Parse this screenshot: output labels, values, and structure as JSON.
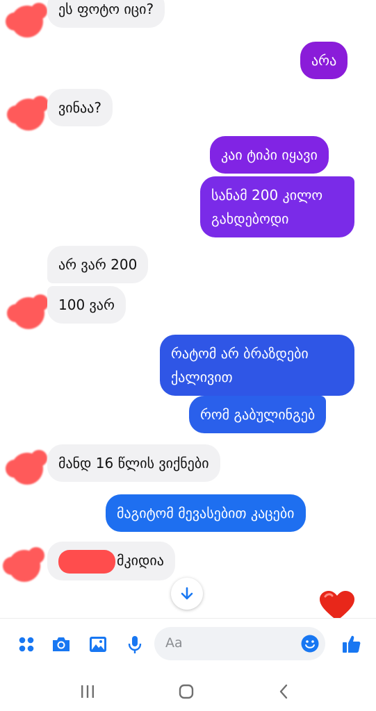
{
  "chat": {
    "messages": [
      {
        "side": "in",
        "text": "ეს ფოტო იცი?"
      },
      {
        "side": "out",
        "text": "არა"
      },
      {
        "side": "in",
        "text": "ვინაა?"
      },
      {
        "side": "out",
        "text": "კაი ტიპი იყავი"
      },
      {
        "side": "out",
        "text": "სანამ 200 კილო გახდებოდი"
      },
      {
        "side": "in",
        "text": "არ ვარ 200"
      },
      {
        "side": "in",
        "text": "100 ვარ"
      },
      {
        "side": "out",
        "text": "რატომ არ ბრაზდები ქალივით"
      },
      {
        "side": "out",
        "text": "რომ გაბულინგებ"
      },
      {
        "side": "in",
        "text": "მანდ 16 წლის ვიქნები"
      },
      {
        "side": "out",
        "text": "მაგიტომ მევასებით კაცები"
      },
      {
        "side": "in",
        "text": "მკიდია"
      }
    ]
  },
  "composer": {
    "placeholder": "Aa",
    "icons": [
      "apps-grid-icon",
      "camera-icon",
      "gallery-icon",
      "microphone-icon",
      "emoji-icon",
      "thumbs-up-icon"
    ]
  },
  "colors": {
    "incoming": "#f1f1f3",
    "outgoing_purple": "#8a1cd9",
    "outgoing_blue": "#1e6ff0",
    "accent": "#1877f2",
    "heart": "#e8271a",
    "avatar_redaction": "#ff5a5a"
  },
  "system_nav": {
    "icons": [
      "recent-apps-icon",
      "home-icon",
      "back-icon"
    ]
  }
}
